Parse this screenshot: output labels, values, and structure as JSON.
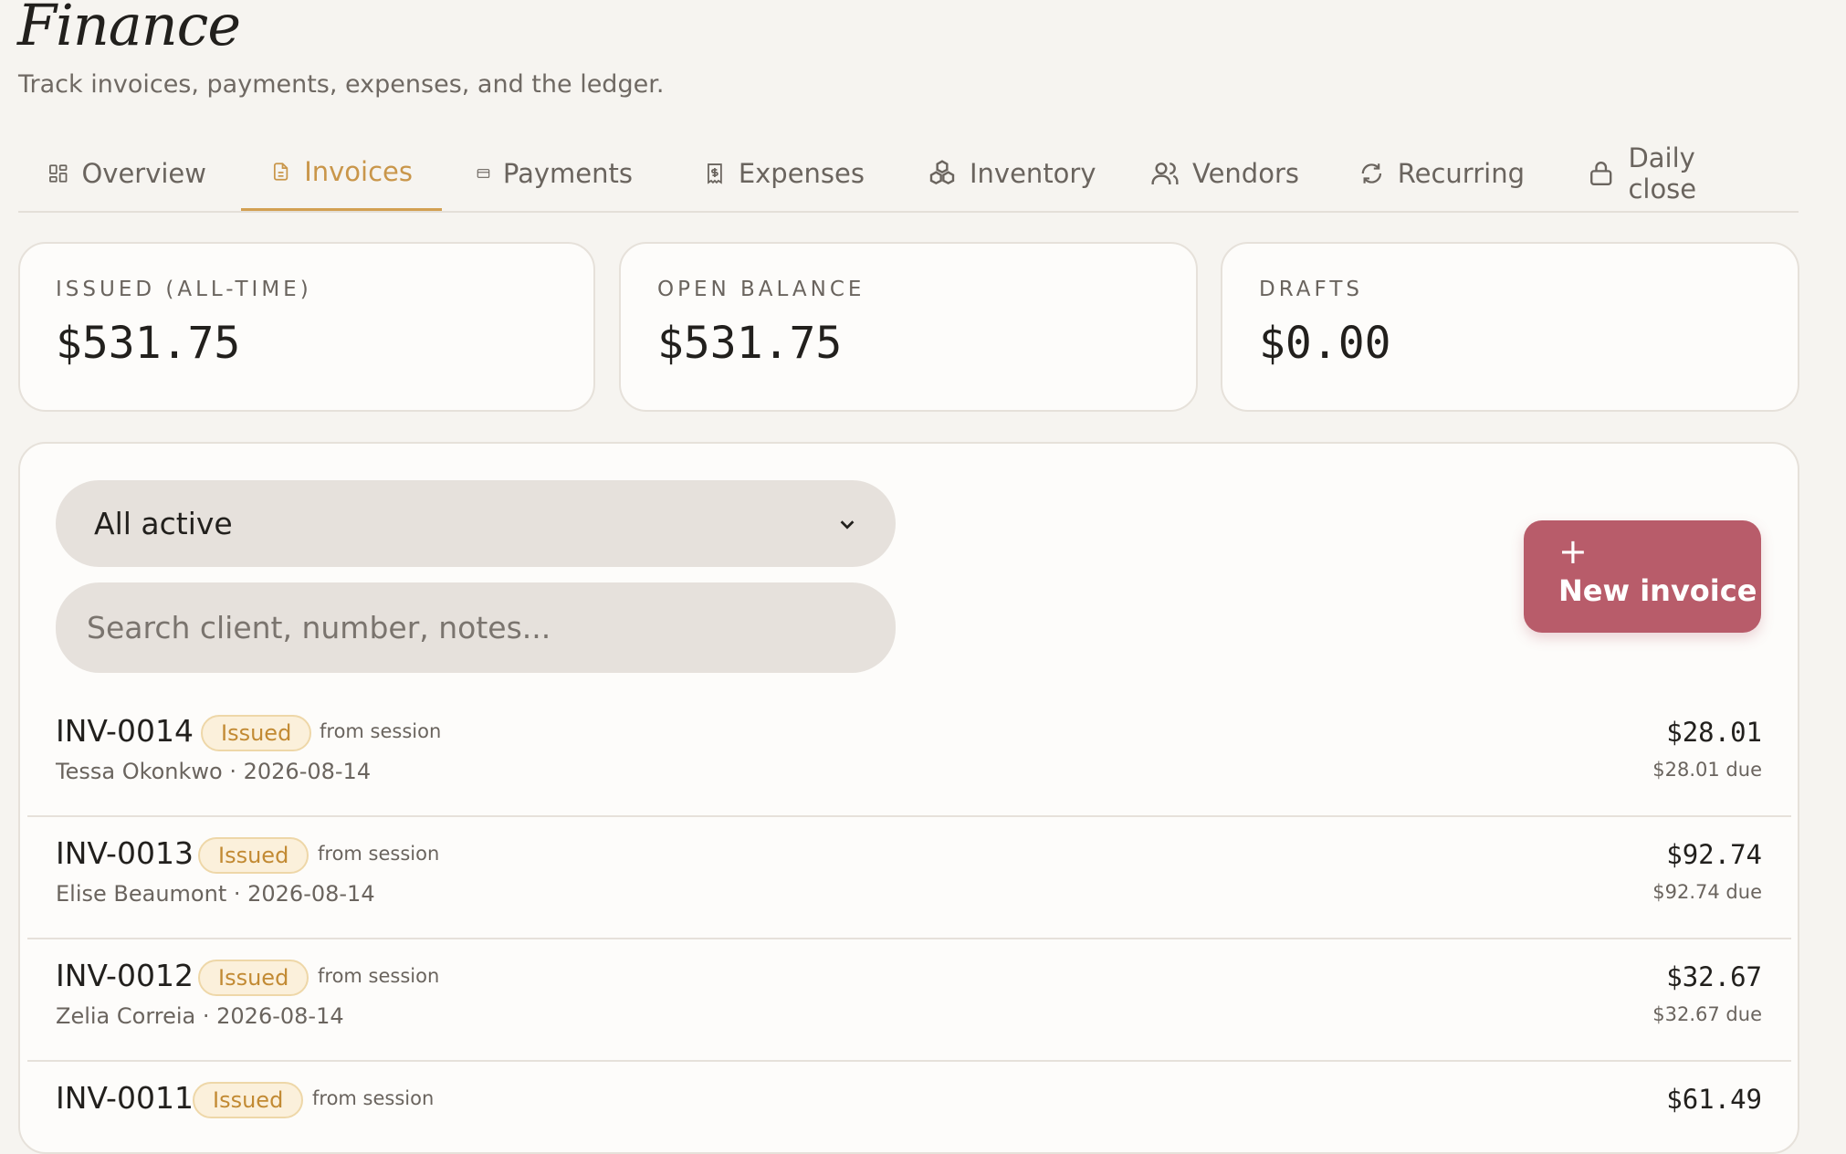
{
  "header": {
    "title": "Finance",
    "subtitle": "Track invoices, payments, expenses, and the ledger."
  },
  "tabs": [
    {
      "label": "Overview",
      "icon": "dashboard-icon",
      "active": false
    },
    {
      "label": "Invoices",
      "icon": "document-icon",
      "active": true
    },
    {
      "label": "Payments",
      "icon": "credit-card-icon",
      "active": false
    },
    {
      "label": "Expenses",
      "icon": "receipt-icon",
      "active": false
    },
    {
      "label": "Inventory",
      "icon": "boxes-icon",
      "active": false
    },
    {
      "label": "Vendors",
      "icon": "users-icon",
      "active": false
    },
    {
      "label": "Recurring",
      "icon": "refresh-icon",
      "active": false
    },
    {
      "label": "Daily close",
      "icon": "lock-icon",
      "active": false
    }
  ],
  "stats": [
    {
      "label": "ISSUED (ALL-TIME)",
      "value": "$531.75"
    },
    {
      "label": "OPEN BALANCE",
      "value": "$531.75"
    },
    {
      "label": "DRAFTS",
      "value": "$0.00"
    }
  ],
  "filters": {
    "status_value": "All active",
    "search_placeholder": "Search client, number, notes..."
  },
  "new_invoice": {
    "icon": "plus-icon",
    "label": "New invoice"
  },
  "invoices": [
    {
      "number": "INV-0014",
      "status": "Issued",
      "source": "from session",
      "meta": "Tessa Okonkwo · 2026-08-14",
      "amount": "$28.01",
      "due": "$28.01 due"
    },
    {
      "number": "INV-0013",
      "status": "Issued",
      "source": "from session",
      "meta": "Elise Beaumont · 2026-08-14",
      "amount": "$92.74",
      "due": "$92.74 due"
    },
    {
      "number": "INV-0012",
      "status": "Issued",
      "source": "from session",
      "meta": "Zelia Correia · 2026-08-14",
      "amount": "$32.67",
      "due": "$32.67 due"
    },
    {
      "number": "INV-0011",
      "status": "Issued",
      "source": "from session",
      "meta": "",
      "amount": "$61.49",
      "due": ""
    }
  ],
  "colors": {
    "background": "#f6f4f0",
    "accent": "#c9964a",
    "primary_button": "#b85c6a",
    "badge_text": "#c28a33",
    "badge_bg": "#fbf0db"
  }
}
